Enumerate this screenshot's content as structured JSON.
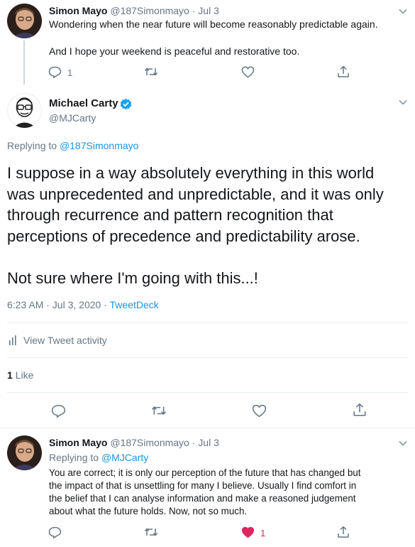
{
  "tweet1": {
    "name": "Simon Mayo",
    "handle": "@187Simonmayo",
    "date": "· Jul 3",
    "line1": "Wondering when the near future will become reasonably predictable again.",
    "line2": "And I hope your weekend is peaceful and restorative too.",
    "reply_count": "1",
    "icons": [
      "reply-icon",
      "retweet-icon",
      "like-icon",
      "share-icon"
    ]
  },
  "main": {
    "name": "Michael Carty",
    "handle": "@MJCarty",
    "verified_icon": "verified-badge-icon",
    "menu_icon": "chevron-down-icon",
    "replying_prefix": "Replying to",
    "replying_to": "@187Simonmayo",
    "body_lines": [
      "I suppose in a way absolutely everything in this world",
      "was unprecedented and unpredictable, and it was only",
      "through recurrence and pattern recognition that",
      "perceptions of precedence and predictability arose."
    ],
    "body_last": "Not sure where I'm going with this...!",
    "timestamp": "6:23 AM · Jul 3, 2020 ·",
    "source": "TweetDeck",
    "activity_icon": "bar-chart-icon",
    "activity_label": "View Tweet activity",
    "like_count": "1",
    "like_label": "Like"
  },
  "tweet3": {
    "name": "Simon Mayo",
    "handle": "@187Simonmayo",
    "date": "· Jul 3",
    "replying_prefix": "Replying to",
    "replying_to": "@MJCarty",
    "lines": [
      "You are correct; it is only our perception of the future that has changed but",
      "the impact of that is unsettling for many I believe.  Usually I find comfort in",
      "the belief that I can analyse information and make a reasoned judgement",
      "about what the future holds. Now, not so much."
    ],
    "like_count": "1",
    "like_color": "#e0245e"
  },
  "colors": {
    "accent": "#1b95e0",
    "muted": "#657786",
    "like": "#e0245e"
  }
}
